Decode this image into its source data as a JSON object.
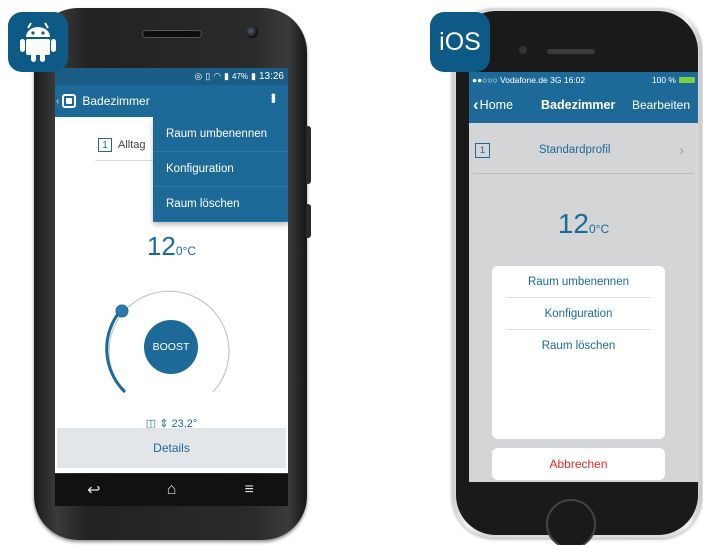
{
  "android": {
    "badge_icon": "android-robot-icon",
    "status_bar": {
      "battery": "47%",
      "time": "13:26"
    },
    "appbar": {
      "title": "Badezimmer"
    },
    "profile": {
      "number": "1",
      "label": "Alltag"
    },
    "menu": [
      "Raum umbenennen",
      "Konfiguration",
      "Raum löschen"
    ],
    "temperature": {
      "value": "12",
      "unit": "0°C"
    },
    "boost_label": "BOOST",
    "window_reading": "23,2°",
    "details_label": "Details",
    "colors": {
      "primary": "#1d6a98",
      "status_bar": "#1a5d86"
    }
  },
  "ios": {
    "badge_label": "iOS",
    "status_bar": {
      "carrier": "●●○○○ Vodafone.de  3G  16:02",
      "battery": "100 %"
    },
    "navbar": {
      "back": "Home",
      "title": "Badezimmer",
      "edit": "Bearbeiten"
    },
    "profile": {
      "number": "1",
      "label": "Standardprofil"
    },
    "temperature": {
      "value": "12",
      "unit": "0°C"
    },
    "action_sheet": [
      "Raum umbenennen",
      "Konfiguration",
      "Raum löschen"
    ],
    "cancel_label": "Abbrechen",
    "colors": {
      "primary": "#1d6a98",
      "cancel": "#e52929"
    }
  }
}
